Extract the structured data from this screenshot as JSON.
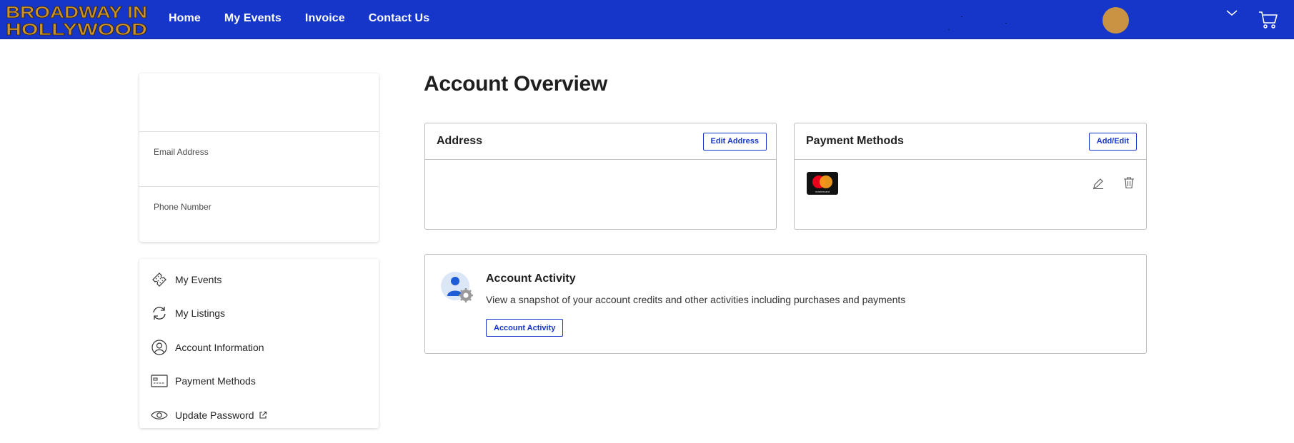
{
  "brand": {
    "logo_line1": "BROADWAY IN",
    "logo_line2": "HOLLYWOOD",
    "logo_color": "#c8922e"
  },
  "nav": {
    "items": [
      {
        "label": "Home"
      },
      {
        "label": "My Events"
      },
      {
        "label": "Invoice"
      },
      {
        "label": "Contact Us"
      }
    ],
    "bar_color": "#1536c9",
    "avatar_color": "#c99343"
  },
  "profile": {
    "email_label": "Email Address",
    "phone_label": "Phone Number"
  },
  "sidebar": {
    "items": [
      {
        "label": "My Events",
        "icon": "tickets-icon"
      },
      {
        "label": "My Listings",
        "icon": "refresh-icon"
      },
      {
        "label": "Account Information",
        "icon": "user-icon"
      },
      {
        "label": "Payment Methods",
        "icon": "card-icon"
      },
      {
        "label": "Update Password",
        "icon": "eye-icon"
      }
    ]
  },
  "main": {
    "title": "Account Overview",
    "address": {
      "title": "Address",
      "edit_label": "Edit Address"
    },
    "payment": {
      "title": "Payment Methods",
      "add_label": "Add/Edit",
      "card_brand": "mastercard"
    },
    "activity": {
      "title": "Account Activity",
      "description": "View a snapshot of your account credits and other activities including purchases and payments",
      "button_label": "Account Activity"
    }
  }
}
